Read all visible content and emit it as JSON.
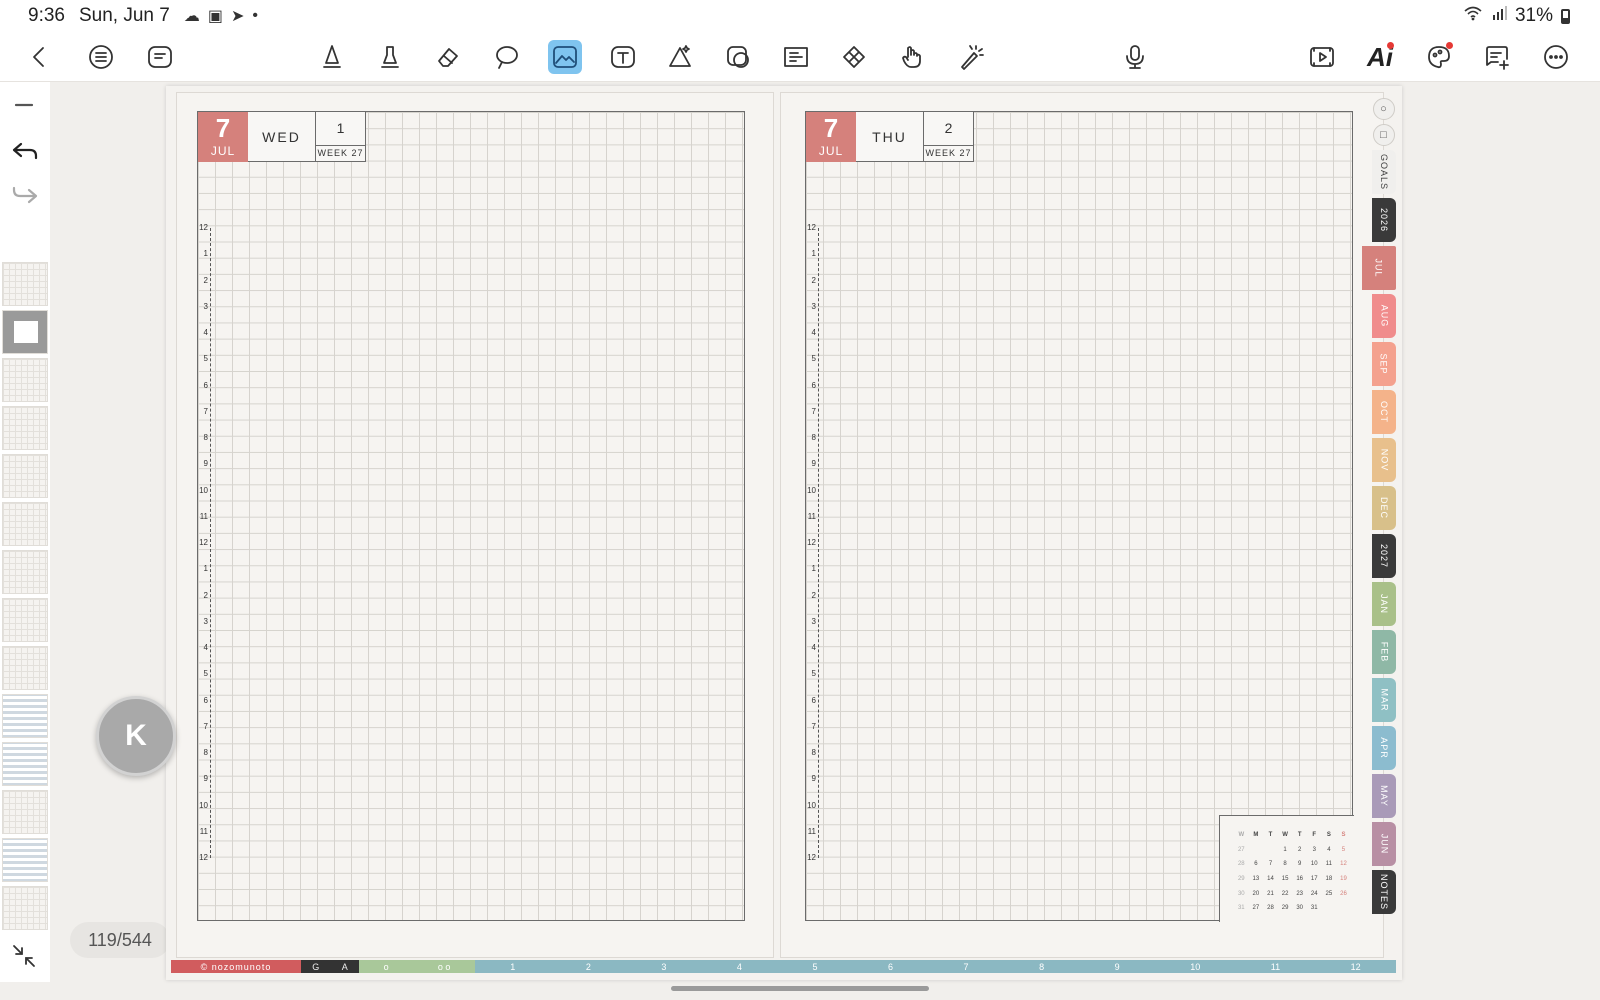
{
  "status_bar": {
    "time": "9:36",
    "date": "Sun, Jun 7",
    "dot": "•",
    "battery": "31%"
  },
  "toolbar": {
    "left_tools": [
      "back-icon",
      "outline-list-icon",
      "text-box-list-icon"
    ],
    "drawing_tools": [
      "pen-icon",
      "highlighter-icon",
      "eraser-icon",
      "lasso-icon",
      "image-icon",
      "text-icon",
      "shapes-icon",
      "sticker-icon",
      "textbox-icon",
      "tape-icon",
      "hand-icon",
      "laser-pointer-icon"
    ],
    "active_tool": "image-icon",
    "right_tools": [
      "microphone-icon",
      "presentation-icon",
      "ai-assistant-icon",
      "theme-icon",
      "add-comment-icon",
      "more-icon"
    ],
    "ai_label": "Ai",
    "accent_color": "#7fc4ef"
  },
  "sidebar": {
    "page_counter": "119/544",
    "k_button_label": "K"
  },
  "left_page": {
    "month_num": "7",
    "month_name": "JUL",
    "day_of_week": "WED",
    "day_number": "1",
    "week_label": "WEEK 27"
  },
  "right_page": {
    "month_num": "7",
    "month_name": "JUL",
    "day_of_week": "THU",
    "day_number": "2",
    "week_label": "WEEK 27"
  },
  "hours": [
    "12",
    "1",
    "2",
    "3",
    "4",
    "5",
    "6",
    "7",
    "8",
    "9",
    "10",
    "11",
    "12",
    "1",
    "2",
    "3",
    "4",
    "5",
    "6",
    "7",
    "8",
    "9",
    "10",
    "11",
    "12"
  ],
  "mini_calendar": {
    "header": [
      "W",
      "M",
      "T",
      "W",
      "T",
      "F",
      "S",
      "S"
    ],
    "rows": [
      [
        "27",
        "",
        "",
        "1",
        "2",
        "3",
        "4",
        "5"
      ],
      [
        "28",
        "6",
        "7",
        "8",
        "9",
        "10",
        "11",
        "12"
      ],
      [
        "29",
        "13",
        "14",
        "15",
        "16",
        "17",
        "18",
        "19"
      ],
      [
        "30",
        "20",
        "21",
        "22",
        "23",
        "24",
        "25",
        "26"
      ],
      [
        "31",
        "27",
        "28",
        "29",
        "30",
        "31",
        "",
        ""
      ]
    ]
  },
  "bottom_strip": {
    "brand": "© nozomunoto",
    "letters": [
      "G",
      "A"
    ],
    "circles": [
      "o",
      "o o"
    ],
    "months": [
      "1",
      "2",
      "3",
      "4",
      "5",
      "6",
      "7",
      "8",
      "9",
      "10",
      "11",
      "12"
    ]
  },
  "side_tabs": [
    {
      "label": "",
      "icon": "circle-icon",
      "color": "#f0efed"
    },
    {
      "label": "",
      "icon": "square-icon",
      "color": "#f0efed"
    },
    {
      "label": "GOALS",
      "color": "#f0efed"
    },
    {
      "label": "2026",
      "color": "#3a3a3a"
    },
    {
      "label": "JUL",
      "color": "#d5817c",
      "selected": true
    },
    {
      "label": "AUG",
      "color": "#f08c8c"
    },
    {
      "label": "SEP",
      "color": "#f4a18e"
    },
    {
      "label": "OCT",
      "color": "#f4b38a"
    },
    {
      "label": "NOV",
      "color": "#e8c08c"
    },
    {
      "label": "DEC",
      "color": "#d8c08a"
    },
    {
      "label": "2027",
      "color": "#3a3a3a"
    },
    {
      "label": "JAN",
      "color": "#a9c089"
    },
    {
      "label": "FEB",
      "color": "#8fb8a6"
    },
    {
      "label": "MAR",
      "color": "#8fc0c4"
    },
    {
      "label": "APR",
      "color": "#8cbccf"
    },
    {
      "label": "MAY",
      "color": "#a99ab8"
    },
    {
      "label": "JUN",
      "color": "#b88fa4"
    },
    {
      "label": "NOTES",
      "color": "#3a3a3a"
    }
  ]
}
